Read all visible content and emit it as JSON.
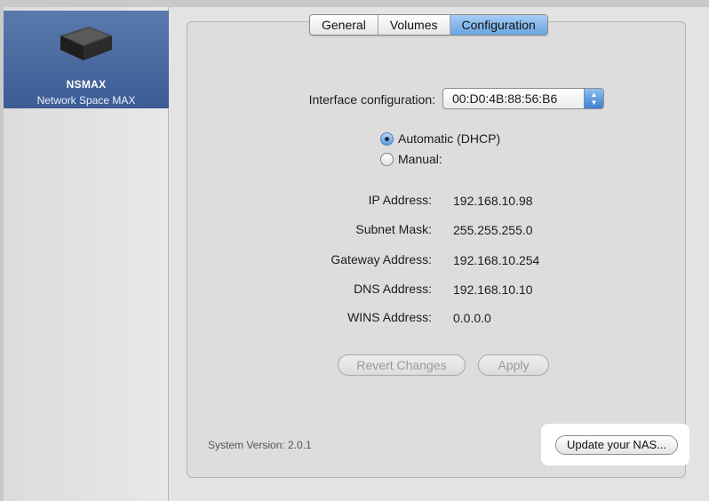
{
  "sidebar": {
    "device": {
      "name": "NSMAX",
      "model": "Network Space MAX"
    }
  },
  "tabs": [
    {
      "label": "General",
      "selected": false
    },
    {
      "label": "Volumes",
      "selected": false
    },
    {
      "label": "Configuration",
      "selected": true
    }
  ],
  "config": {
    "interface_label": "Interface configuration:",
    "interface_value": "00:D0:4B:88:56:B6",
    "mode_options": [
      {
        "label": "Automatic (DHCP)",
        "selected": true
      },
      {
        "label": "Manual:",
        "selected": false
      }
    ],
    "fields": [
      {
        "label": "IP Address:",
        "value": "192.168.10.98"
      },
      {
        "label": "Subnet Mask:",
        "value": "255.255.255.0"
      },
      {
        "label": "Gateway Address:",
        "value": "192.168.10.254"
      },
      {
        "label": "DNS Address:",
        "value": "192.168.10.10"
      },
      {
        "label": "WINS Address:",
        "value": "0.0.0.0"
      }
    ],
    "revert_label": "Revert Changes",
    "apply_label": "Apply"
  },
  "footer": {
    "system_version": "System Version: 2.0.1",
    "update_label": "Update your NAS..."
  },
  "colors": {
    "sidebar_selection": "#3b5c94",
    "tab_selected": "#6aa5e3",
    "highlight": "#ffffff"
  }
}
